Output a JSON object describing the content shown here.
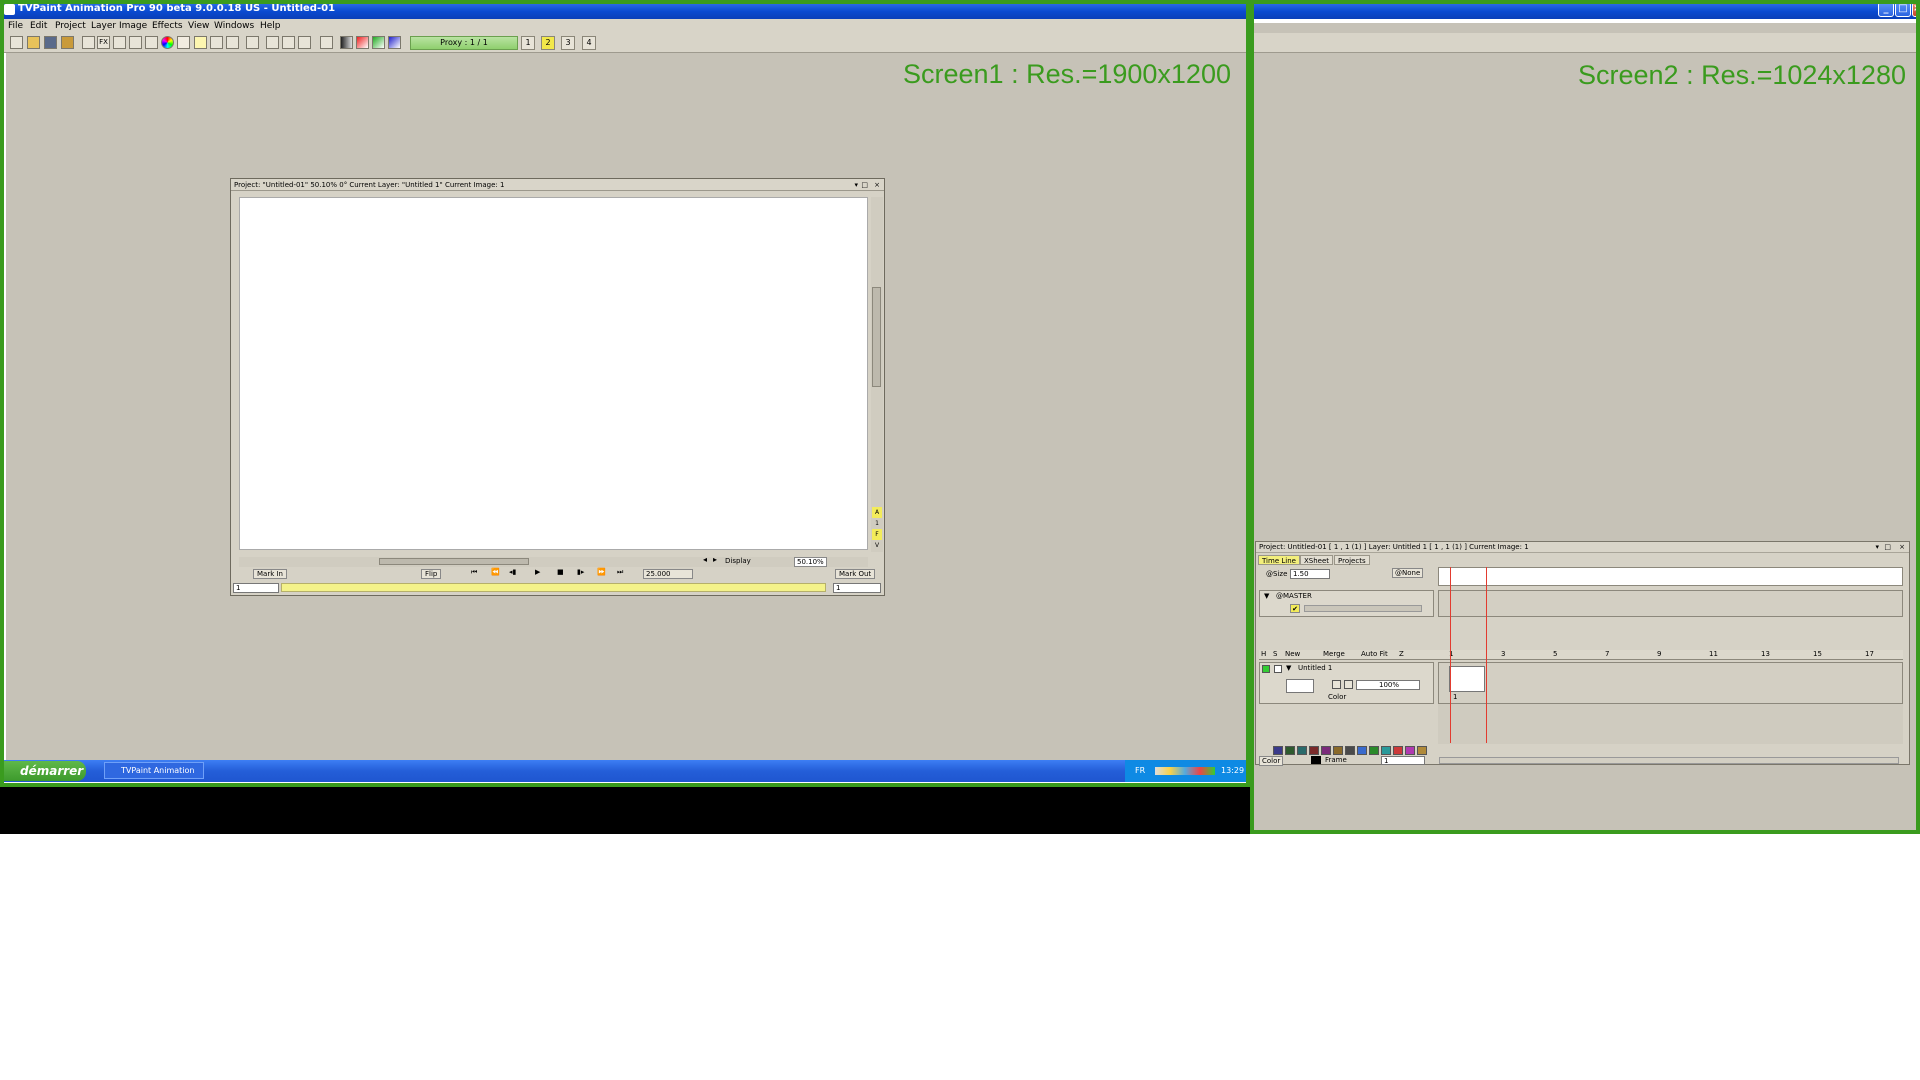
{
  "window": {
    "title": "TVPaint Animation Pro 90 beta 9.0.0.18 US - Untitled-01"
  },
  "menu": [
    "File",
    "Edit",
    "Project",
    "Layer",
    "Image",
    "Effects",
    "View",
    "Windows",
    "Help"
  ],
  "toolbar": {
    "proxy_label": "Proxy : 1 / 1",
    "page_buttons": [
      "1",
      "2",
      "3",
      "4"
    ],
    "active_page": "2",
    "icons": [
      "new-icon",
      "open-icon",
      "save-icon",
      "save-as-icon",
      "tools-icon",
      "fx-icon",
      "zoom-icon",
      "play-icon",
      "layers-icon",
      "color-wheel-icon",
      "palette-icon",
      "light-icon",
      "grid-icon",
      "crosshair-icon",
      "frame-icon",
      "view-icon",
      "view2-icon",
      "view3-icon",
      "view4-icon",
      "view5-icon",
      "gradient-icon",
      "red-gradient-icon",
      "green-gradient-icon",
      "blue-gradient-icon"
    ]
  },
  "labels": {
    "screen1": "Screen1 :  Res.=1900x1200",
    "screen2": "Screen2 :  Res.=1024x1280"
  },
  "project_window": {
    "title": "Project: \"Untitled-01\"  50.10%  0°  Current Layer: \"Untitled 1\"  Current Image: 1",
    "mark_in": "Mark In",
    "mark_out": "Mark Out",
    "flip": "Flip",
    "fps": "25.000",
    "display": "Display",
    "zoom": "50.10%",
    "in_value": "1",
    "out_value": "1",
    "side_letters": [
      "A",
      "1",
      "F",
      "V"
    ]
  },
  "taskbar": {
    "start": "démarrer",
    "task_item": "TVPaint Animation Pr...",
    "lang": "FR",
    "clock": "13:29"
  },
  "timeline_window": {
    "title": "Project: Untitled-01 [ 1 , 1  (1) ]      Layer: Untitled 1 [ 1 , 1  (1) ]      Current Image: 1",
    "tabs": [
      "Time Line",
      "XSheet",
      "Projects"
    ],
    "active_tab": "Time Line",
    "size_label": "@Size",
    "size_value": "1.50",
    "none_label": "@None",
    "master_label": "@MASTER",
    "headers": [
      "H",
      "S",
      "New",
      "Merge",
      "Auto Fit",
      "Z"
    ],
    "ruler": [
      "1",
      "3",
      "5",
      "7",
      "9",
      "11",
      "13",
      "15",
      "17"
    ],
    "layer_name": "Untitled 1",
    "opacity": "100%",
    "layer_type": "Color",
    "frame_number": "1",
    "bottom_mode": "Color",
    "frame_label": "Frame",
    "frame_value": "1",
    "swatch_colors": [
      "#3a3a8a",
      "#2e5a2e",
      "#2a6a6a",
      "#7a2a2a",
      "#7a2a7a",
      "#8a6a2a",
      "#4a4a4a",
      "#3a6acc",
      "#2a8a2a",
      "#2a9a9a",
      "#cc3a3a",
      "#b03ab0",
      "#b08a3a"
    ]
  },
  "colors": {
    "frame_green": "#3a9b1e",
    "workarea": "#c6c2b7",
    "titlebar_blue": "#0a4ad0",
    "timeline_yellow": "#f4f28a"
  }
}
